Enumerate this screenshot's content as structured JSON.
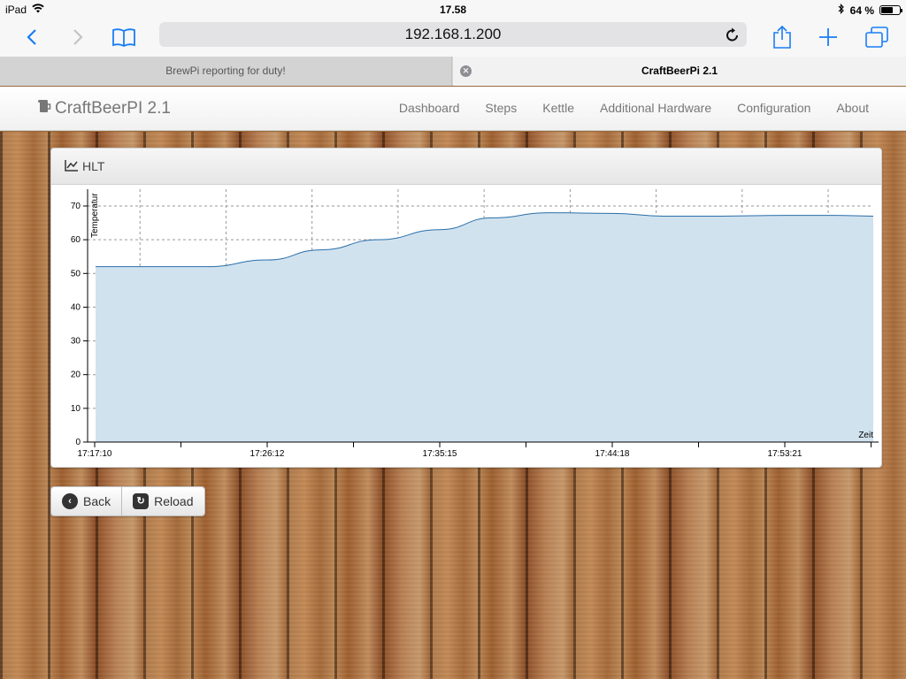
{
  "status_bar": {
    "device": "iPad",
    "time": "17.58",
    "battery_text": "64 %",
    "battery_level": 0.64
  },
  "browser": {
    "url": "192.168.1.200",
    "tabs": [
      {
        "title": "BrewPi reporting for duty!",
        "active": false
      },
      {
        "title": "CraftBeerPi 2.1",
        "active": true
      }
    ]
  },
  "navbar": {
    "brand": "CraftBeerPI 2.1",
    "links": [
      "Dashboard",
      "Steps",
      "Kettle",
      "Additional Hardware",
      "Configuration",
      "About"
    ]
  },
  "panel": {
    "title": "HLT"
  },
  "chart_data": {
    "type": "area",
    "title": "HLT",
    "xlabel": "Zeit",
    "ylabel": "Temperatur",
    "ylim": [
      0,
      70
    ],
    "y_ticks": [
      0,
      10,
      20,
      30,
      40,
      50,
      60,
      70
    ],
    "x_tick_labels": [
      "17:17:10",
      "17:26:12",
      "17:35:15",
      "17:44:18",
      "17:53:21"
    ],
    "x_range": [
      "17:17:10",
      "17:58:00"
    ],
    "grid": true,
    "fill_color": "#d1e2ef",
    "line_color": "#2a6fa8",
    "series": [
      {
        "x": [
          "17:17:10",
          "17:20:00",
          "17:23:00",
          "17:26:12",
          "17:29:00",
          "17:32:00",
          "17:35:15",
          "17:38:00",
          "17:41:00",
          "17:44:18",
          "17:47:00",
          "17:50:00",
          "17:53:21",
          "17:56:00",
          "17:58:00"
        ],
        "values": [
          52,
          52,
          52,
          54,
          57,
          60,
          63,
          66.5,
          68,
          67.8,
          67,
          67,
          67.2,
          67.2,
          67
        ]
      }
    ]
  },
  "buttons": {
    "back": "Back",
    "reload": "Reload"
  }
}
